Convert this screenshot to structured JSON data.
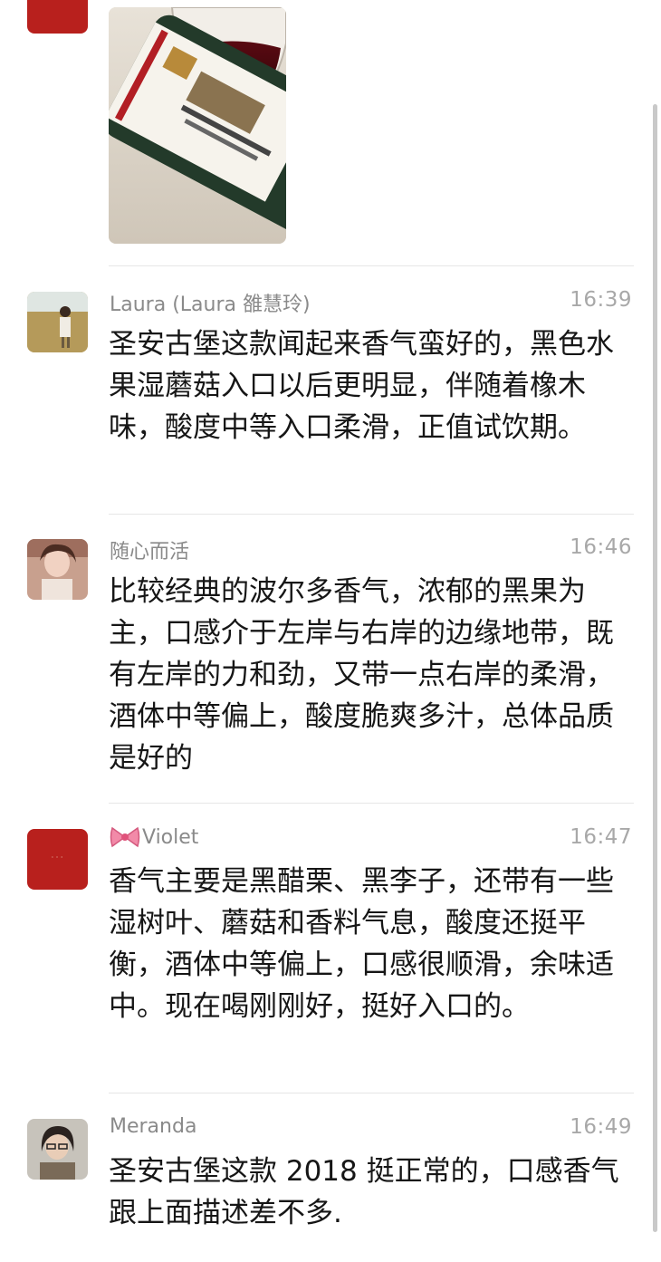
{
  "colors": {
    "name": "#8a8a8a",
    "time": "#a8a8a8",
    "text": "#161616",
    "divider": "#e6e6e6"
  },
  "top_message": {
    "image": "wine-photo"
  },
  "messages": [
    {
      "name": "Laura (Laura 雒慧玲)",
      "time": "16:39",
      "text": "圣安古堡这款闻起来香气蛮好的，黑色水果湿蘑菇入口以后更明显，伴随着橡木味，酸度中等入口柔滑，正值试饮期。"
    },
    {
      "name": "随心而活",
      "time": "16:46",
      "text": "比较经典的波尔多香气，浓郁的黑果为主，口感介于左岸与右岸的边缘地带，既有左岸的力和劲，又带一点右岸的柔滑，酒体中等偏上，酸度脆爽多汁，总体品质是好的"
    },
    {
      "name": "Violet",
      "name_icon": "ribbon-bow-icon",
      "time": "16:47",
      "text": "香气主要是黑醋栗、黑李子，还带有一些湿树叶、蘑菇和香料气息，酸度还挺平衡，酒体中等偏上，口感很顺滑，余味适中。现在喝刚刚好，挺好入口的。"
    },
    {
      "name": "Meranda",
      "time": "16:49",
      "text": "圣安古堡这款 2018 挺正常的，口感香气跟上面描述差不多."
    }
  ]
}
